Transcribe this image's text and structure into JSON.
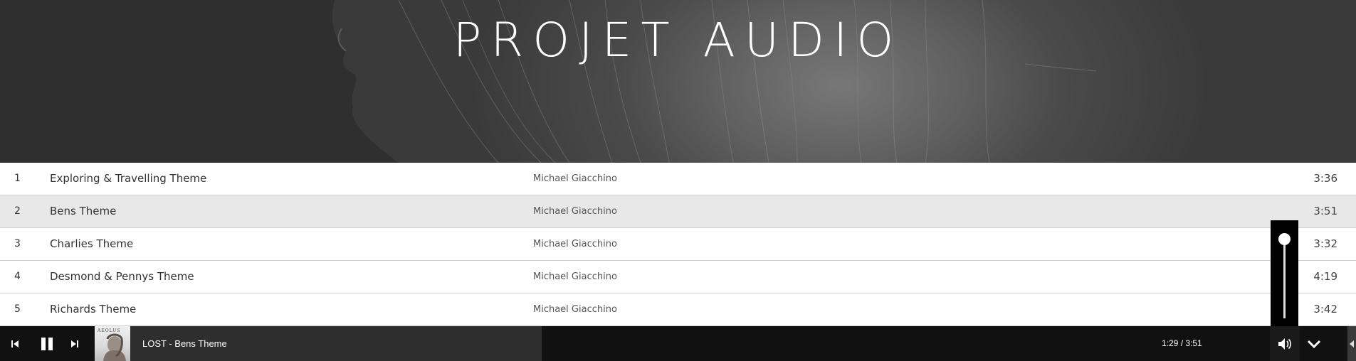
{
  "hero": {
    "title": "PROJET AUDIO"
  },
  "tracks": [
    {
      "num": "1",
      "title": "Exploring & Travelling Theme",
      "artist": "Michael Giacchino",
      "duration": "3:36",
      "active": false
    },
    {
      "num": "2",
      "title": "Bens Theme",
      "artist": "Michael Giacchino",
      "duration": "3:51",
      "active": true
    },
    {
      "num": "3",
      "title": "Charlies Theme",
      "artist": "Michael Giacchino",
      "duration": "3:32",
      "active": false
    },
    {
      "num": "4",
      "title": "Desmond & Pennys Theme",
      "artist": "Michael Giacchino",
      "duration": "4:19",
      "active": false
    },
    {
      "num": "5",
      "title": "Richards Theme",
      "artist": "Michael Giacchino",
      "duration": "3:42",
      "active": false
    }
  ],
  "player": {
    "now_playing": "LOST - Bens Theme",
    "time": "1:29 / 3:51",
    "cover_text": "AEOLUS",
    "progress_fraction": 0.386,
    "volume_level": 1.0
  },
  "icons": {
    "prev": "skip-previous-icon",
    "pause": "pause-icon",
    "next": "skip-next-icon",
    "volume": "volume-icon",
    "collapse": "chevron-down-icon",
    "edge": "caret-left-icon"
  },
  "colors": {
    "hero_bg": "#444444",
    "player_bg": "#111111",
    "progress_bg": "#2e2e2e",
    "active_row": "#e8e8e8",
    "text_light": "#ffffff"
  }
}
